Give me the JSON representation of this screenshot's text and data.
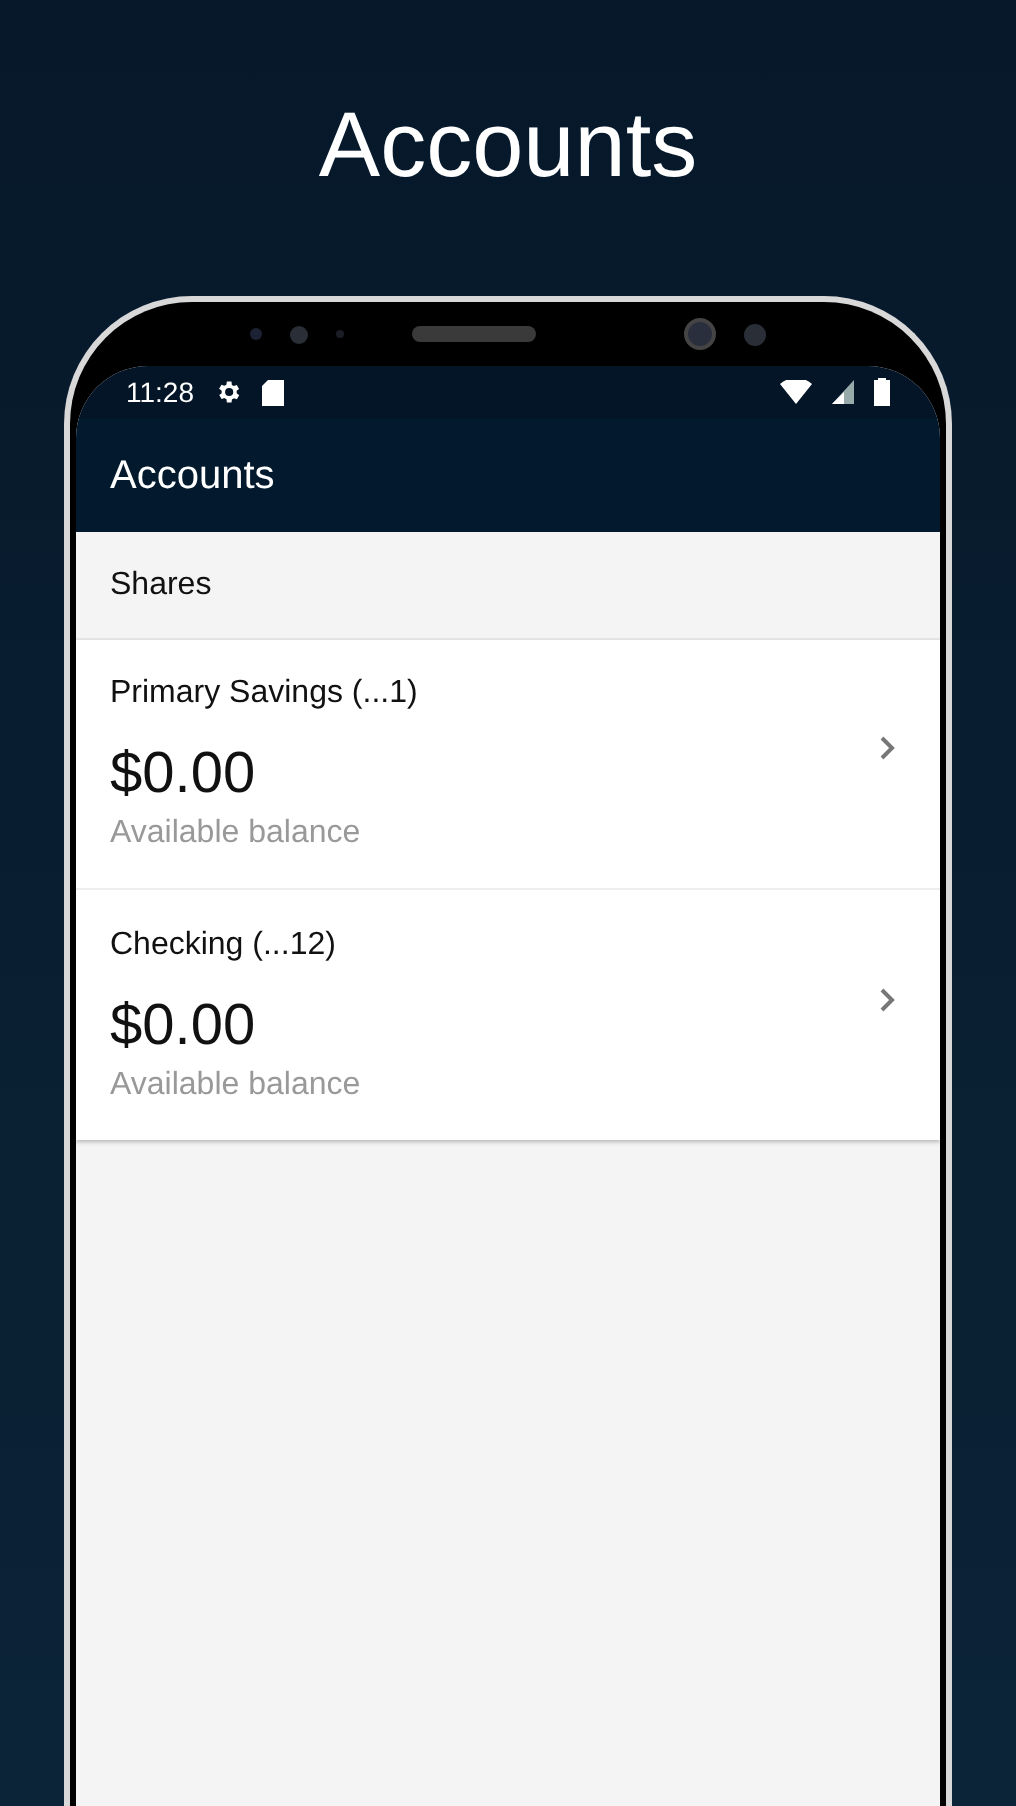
{
  "headline": "Accounts",
  "status_bar": {
    "time": "11:28"
  },
  "app_bar": {
    "title": "Accounts"
  },
  "section": {
    "title": "Shares"
  },
  "accounts": [
    {
      "name": "Primary Savings (...1)",
      "balance": "$0.00",
      "balance_label": "Available balance"
    },
    {
      "name": "Checking (...12)",
      "balance": "$0.00",
      "balance_label": "Available balance"
    }
  ]
}
